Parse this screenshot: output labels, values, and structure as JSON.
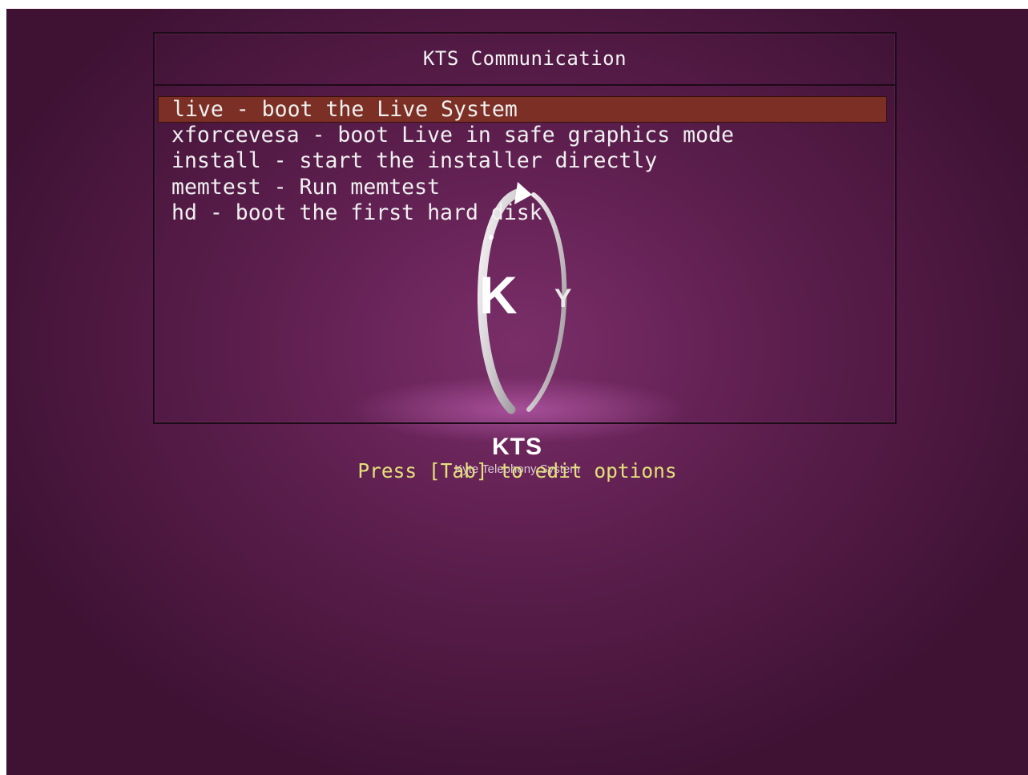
{
  "window": {
    "title": "KTS Communication"
  },
  "menu": {
    "items": [
      {
        "label": "live - boot the Live System",
        "selected": true
      },
      {
        "label": "xforcevesa - boot Live in safe graphics mode",
        "selected": false
      },
      {
        "label": "install - start the installer directly",
        "selected": false
      },
      {
        "label": "memtest - Run memtest",
        "selected": false
      },
      {
        "label": "hd - boot the first hard disk",
        "selected": false
      }
    ]
  },
  "logo": {
    "icon": "kts-logo-icon",
    "letters": [
      "K",
      "Y"
    ],
    "name": "KTS",
    "tagline": "Kyte Telephony System"
  },
  "footer": {
    "hint": "Press [Tab] to edit options"
  },
  "colors": {
    "background": "#5e1f4f",
    "selection": "#7c2f24",
    "menu_text": "#f0f0f0",
    "hint_text": "#e3e07a"
  }
}
